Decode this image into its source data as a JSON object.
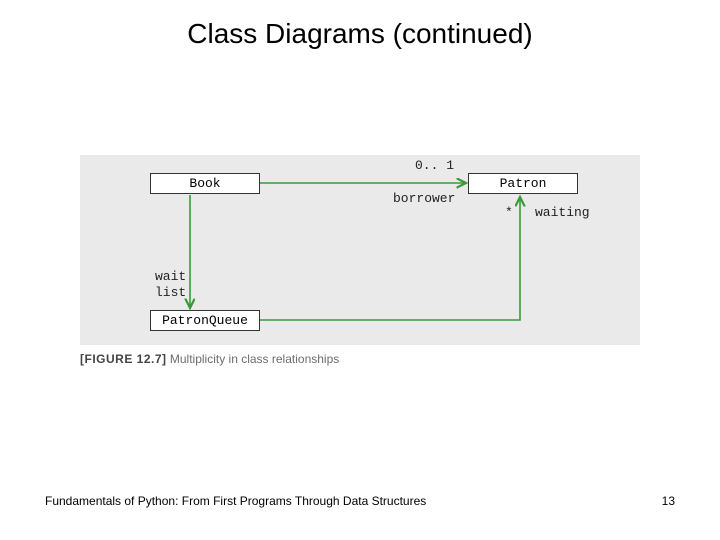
{
  "title": "Class Diagrams (continued)",
  "classes": {
    "book": "Book",
    "patron": "Patron",
    "patronqueue": "PatronQueue"
  },
  "labels": {
    "borrower_mult": "0.. 1",
    "borrower_role": "borrower",
    "waiting_star": "*",
    "waiting_role": "waiting",
    "waitlist_line1": "wait",
    "waitlist_line2": "list"
  },
  "caption": {
    "figlabel": "[FIGURE 12.7]",
    "text": "Multiplicity in class relationships"
  },
  "footer": {
    "left": "Fundamentals of Python: From First Programs Through Data Structures",
    "right": "13"
  },
  "colors": {
    "arrow": "#3a9a3a"
  }
}
